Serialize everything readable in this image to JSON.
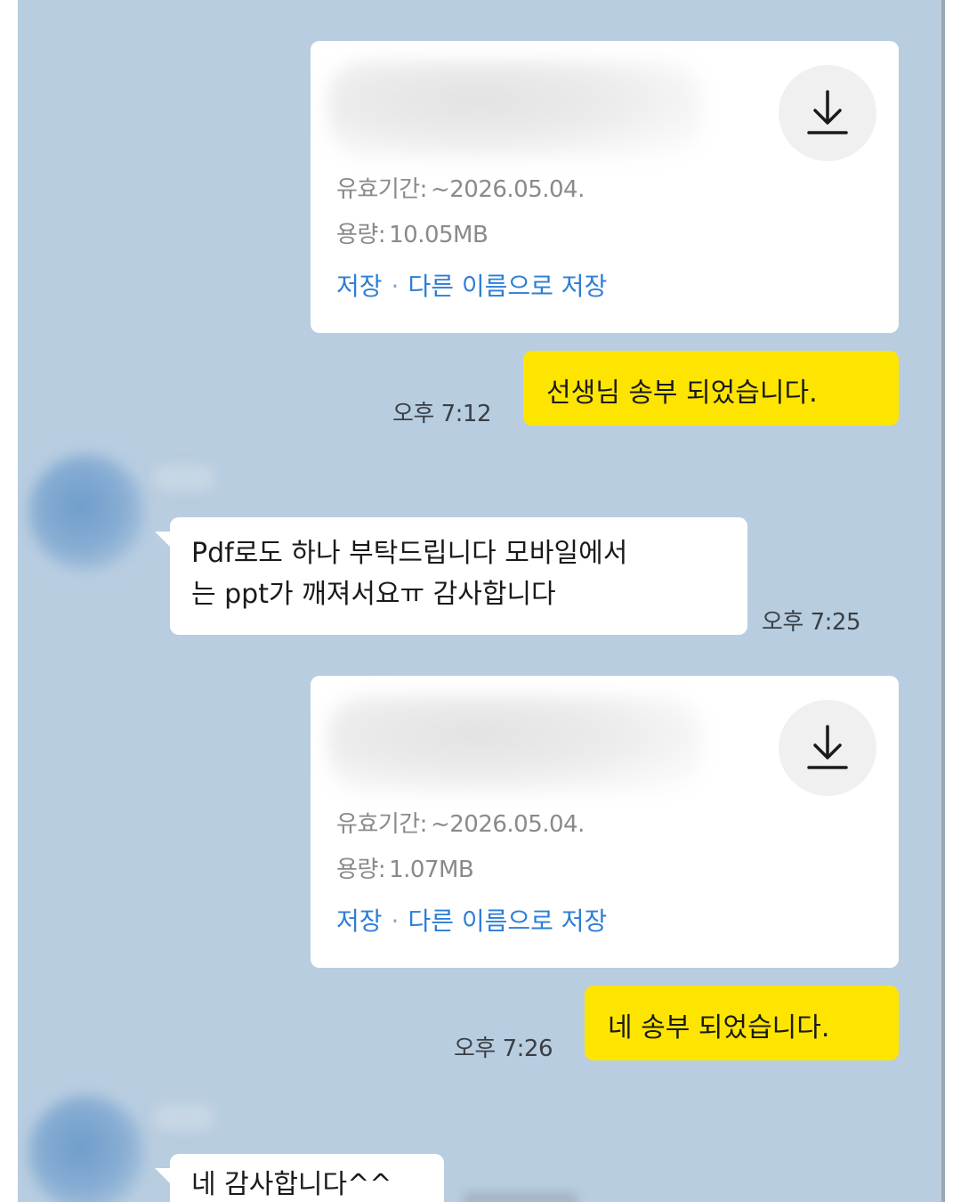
{
  "messages": {
    "file1": {
      "expiry_label": "유효기간:",
      "expiry_value": "~2026.05.04.",
      "size_label": "용량:",
      "size_value": "10.05MB",
      "save_label": "저장",
      "separator": "·",
      "save_as_label": "다른 이름으로 저장",
      "icon": "download-icon"
    },
    "msg1": {
      "text": "선생님 송부 되었습니다.",
      "time": "오후 7:12"
    },
    "reply1": {
      "line1": "Pdf로도 하나 부탁드립니다 모바일에서",
      "line2": "는 ppt가 깨져서요ㅠ 감사합니다",
      "time": "오후 7:25"
    },
    "file2": {
      "expiry_label": "유효기간:",
      "expiry_value": "~2026.05.04.",
      "size_label": "용량:",
      "size_value": "1.07MB",
      "save_label": "저장",
      "separator": "·",
      "save_as_label": "다른 이름으로 저장",
      "icon": "download-icon"
    },
    "msg2": {
      "text": "네 송부 되었습니다.",
      "time": "오후 7:26"
    },
    "reply2": {
      "text": "네 감사합니다^^"
    }
  },
  "colors": {
    "chat_background": "#b8cde0",
    "my_bubble": "#fee500",
    "other_bubble": "#ffffff",
    "link": "#2d7ed6"
  }
}
